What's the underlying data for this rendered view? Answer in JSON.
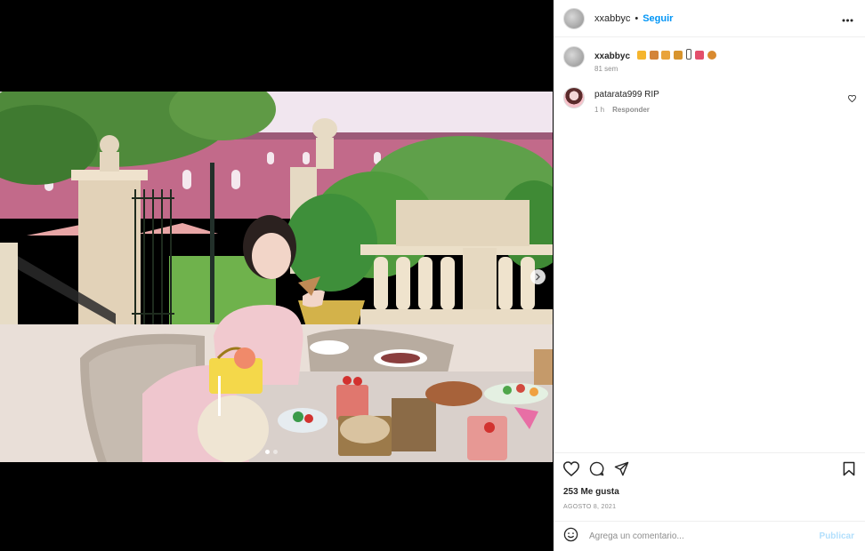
{
  "post": {
    "author": "xxabbyc",
    "separator": "•",
    "follow_label": "Seguir",
    "more_icon": "more-horizontal-icon"
  },
  "caption": {
    "author": "xxabbyc",
    "emojis": [
      "bread",
      "cookie",
      "croissant",
      "curry-puff",
      "unknown-glyph",
      "cupcake",
      "cookie"
    ],
    "emoji_colors": [
      "#f5b52e",
      "#d3843a",
      "#e9a33b",
      "#d8942d",
      "#ffffff",
      "#e34f6b",
      "#d98a2f"
    ],
    "time": "81 sem"
  },
  "comment": {
    "author": "patarata999",
    "text": "RIP",
    "time": "1 h",
    "reply_label": "Responder"
  },
  "actions": {
    "likes": "253 Me gusta",
    "date": "AGOSTO 8, 2021"
  },
  "composer": {
    "placeholder": "Agrega un comentario...",
    "publish_label": "Publicar"
  },
  "carousel": {
    "current": 1,
    "total": 2
  },
  "colors": {
    "accent": "#0095f6",
    "text": "#262626",
    "muted": "#8e8e8e",
    "publish_disabled": "#b2dffc"
  }
}
